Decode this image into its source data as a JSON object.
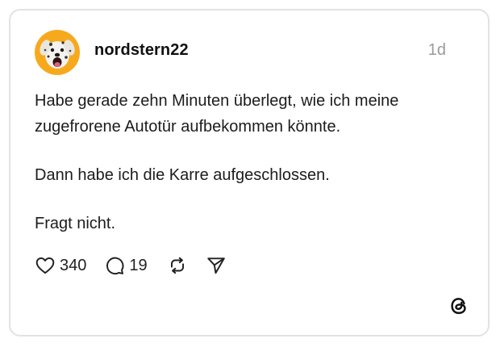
{
  "post": {
    "username": "nordstern22",
    "timestamp": "1d",
    "paragraphs": [
      "Habe gerade zehn Minuten überlegt, wie ich meine zugefrorene Autotür aufbekommen könnte.",
      "Dann habe ich die Karre aufgeschlossen.",
      "Fragt nicht."
    ],
    "avatar": {
      "icon": "dalmatian-dog-avatar",
      "background_color": "#f7a91e"
    }
  },
  "actions": {
    "likes": {
      "icon": "heart-icon",
      "count": "340"
    },
    "replies": {
      "icon": "comment-icon",
      "count": "19"
    },
    "repost": {
      "icon": "repost-icon"
    },
    "share": {
      "icon": "send-icon"
    }
  },
  "branding": {
    "logo": "threads-logo-icon"
  },
  "colors": {
    "card_border": "#e2e2e2",
    "text": "#1c1c1c",
    "muted": "#9a9a9a"
  }
}
